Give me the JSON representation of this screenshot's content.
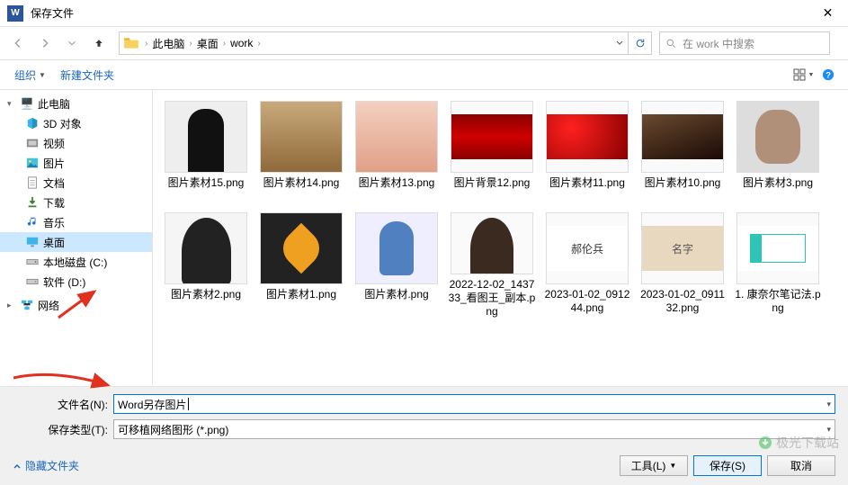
{
  "window": {
    "title": "保存文件"
  },
  "nav": {
    "breadcrumb": {
      "root_sep": "›",
      "p1": "此电脑",
      "p2": "桌面",
      "p3": "work"
    },
    "search_placeholder": "在 work 中搜索"
  },
  "toolbar": {
    "organize": "组织",
    "new_folder": "新建文件夹"
  },
  "sidebar": {
    "this_pc": "此电脑",
    "objects3d": "3D 对象",
    "videos": "视频",
    "pictures": "图片",
    "documents": "文档",
    "downloads": "下载",
    "music": "音乐",
    "desktop": "桌面",
    "local_c": "本地磁盘 (C:)",
    "software_d": "软件 (D:)",
    "network": "网络"
  },
  "files": {
    "f0": "图片素材15.png",
    "f1": "图片素材14.png",
    "f2": "图片素材13.png",
    "f3": "图片背景12.png",
    "f4": "图片素材11.png",
    "f5": "图片素材10.png",
    "f6": "图片素材3.png",
    "f7": "图片素材2.png",
    "f8": "图片素材1.png",
    "f9": "图片素材.png",
    "f10": "2022-12-02_143733_看图王_副本.png",
    "f11": "2023-01-02_091244.png",
    "f12": "2023-01-02_091132.png",
    "f13": "1. 康奈尔笔记法.png",
    "hw1": "郝伦兵",
    "hw2": "名字"
  },
  "form": {
    "filename_label": "文件名(N):",
    "filename_value": "Word另存图片",
    "filetype_label": "保存类型(T):",
    "filetype_value": "可移植网络图形 (*.png)"
  },
  "footer": {
    "hide_folders": "隐藏文件夹",
    "tools": "工具(L)",
    "save": "保存(S)",
    "cancel": "取消"
  },
  "watermark": "极光下载站"
}
